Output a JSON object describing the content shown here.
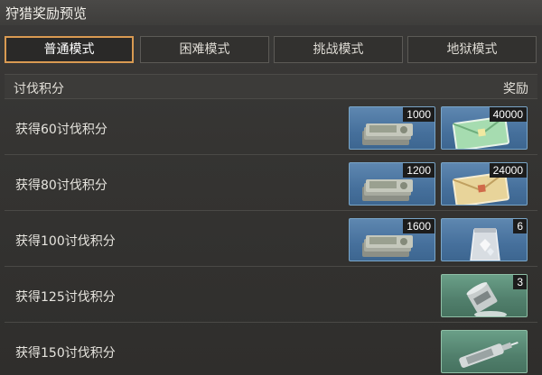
{
  "window": {
    "title": "狩猎奖励预览"
  },
  "tabs": [
    {
      "label": "普通模式",
      "active": true
    },
    {
      "label": "困难模式",
      "active": false
    },
    {
      "label": "挑战模式",
      "active": false
    },
    {
      "label": "地狱模式",
      "active": false
    }
  ],
  "table": {
    "header_left": "讨伐积分",
    "header_right": "奖励",
    "rows": [
      {
        "label": "获得60讨伐积分",
        "items": [
          {
            "icon": "cash-stack-icon",
            "quantity": "1000",
            "color": "blue"
          },
          {
            "icon": "green-envelope-icon",
            "quantity": "40000",
            "color": "blue"
          }
        ]
      },
      {
        "label": "获得80讨伐积分",
        "items": [
          {
            "icon": "cash-stack-icon",
            "quantity": "1200",
            "color": "blue"
          },
          {
            "icon": "yellow-envelope-icon",
            "quantity": "24000",
            "color": "blue"
          }
        ]
      },
      {
        "label": "获得100讨伐积分",
        "items": [
          {
            "icon": "cash-stack-icon",
            "quantity": "1600",
            "color": "blue"
          },
          {
            "icon": "crystal-bag-icon",
            "quantity": "6",
            "color": "blue"
          }
        ]
      },
      {
        "label": "获得125讨伐积分",
        "items": [
          {
            "icon": "paint-can-icon",
            "quantity": "3",
            "color": "green"
          }
        ]
      },
      {
        "label": "获得150讨伐积分",
        "items": [
          {
            "icon": "syringe-icon",
            "quantity": "",
            "color": "green"
          }
        ]
      }
    ]
  },
  "colors": {
    "active_tab_border": "#d99a52",
    "blue_item": "#4f7aa5",
    "green_item": "#5a8c77"
  }
}
